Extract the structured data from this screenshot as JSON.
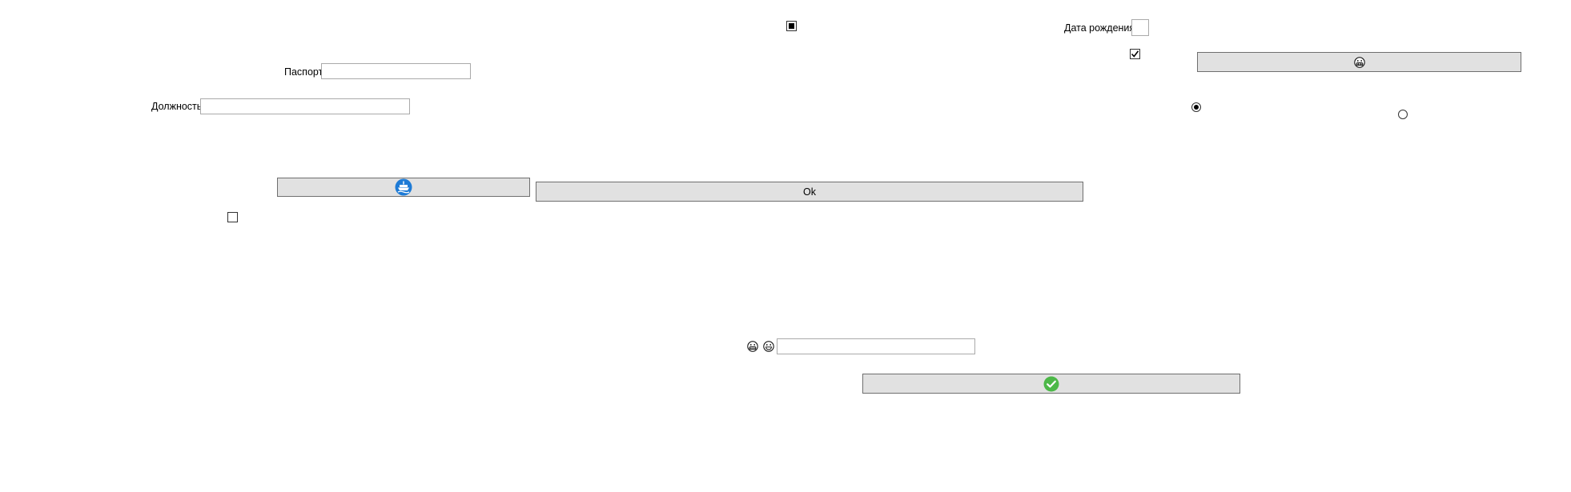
{
  "labels": {
    "birth_date": "Дата рождения",
    "passport": "Паспорт",
    "position": "Должность"
  },
  "inputs": {
    "birth_date_value": "",
    "passport_value": "",
    "position_value": "",
    "bottom_value": ""
  },
  "buttons": {
    "ok_label": "Ok"
  },
  "checkboxes": {
    "top_center": "indeterminate",
    "top_right": "checked",
    "left": "unchecked"
  },
  "radios": {
    "first": "selected",
    "second": "unselected"
  },
  "icons": {
    "grimace_button": "grimacing-face-icon",
    "ship_button": "ship-icon",
    "check_button": "green-check-circle-icon",
    "smiley_1": "grimacing-face-icon",
    "smiley_2": "grinning-face-icon"
  },
  "colors": {
    "button_bg": "#e1e1e1",
    "ship_blue": "#1e7bd6",
    "check_green": "#4cb848"
  }
}
